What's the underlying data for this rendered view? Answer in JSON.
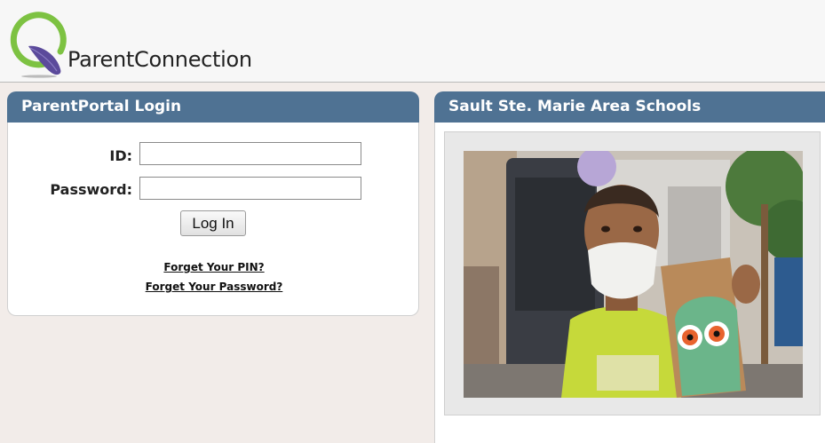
{
  "header": {
    "brand_name": "ParentConnection"
  },
  "login_panel": {
    "title": "ParentPortal Login",
    "id_label": "ID:",
    "id_value": "",
    "password_label": "Password:",
    "password_value": "",
    "login_button": "Log In",
    "forgot_pin_link": "Forget Your PIN?",
    "forgot_password_link": "Forget Your Password?"
  },
  "school_panel": {
    "title": "Sault Ste. Marie Area Schools",
    "photo_icon": "student-photo"
  },
  "colors": {
    "panel_header": "#4f7293",
    "logo_green": "#7dc242",
    "logo_purple": "#5b4a9b"
  }
}
